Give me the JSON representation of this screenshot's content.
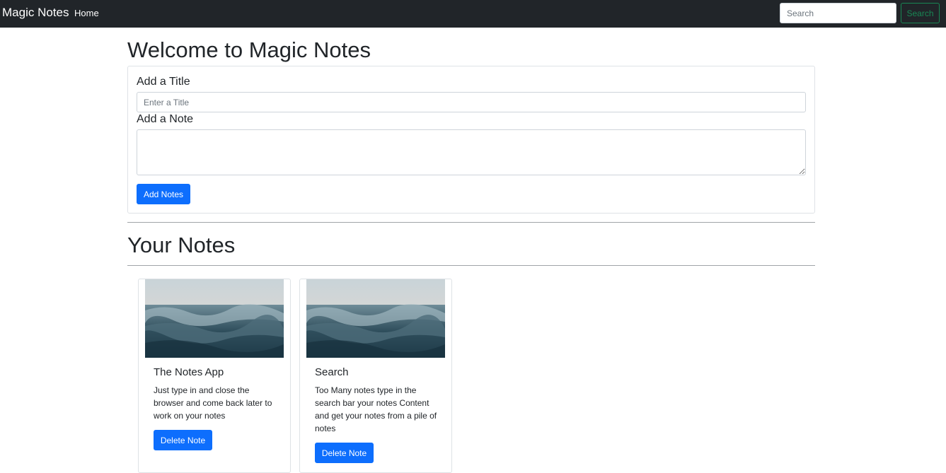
{
  "navbar": {
    "brand": "Magic Notes",
    "home_label": "Home",
    "search_placeholder": "Search",
    "search_button_label": "Search"
  },
  "main": {
    "welcome_heading": "Welcome to Magic Notes",
    "form": {
      "title_label": "Add a Title",
      "title_placeholder": "Enter a Title",
      "note_label": "Add a Note",
      "note_value": "",
      "add_button_label": "Add Notes"
    },
    "notes_heading": "Your Notes",
    "notes": [
      {
        "title": "The Notes App",
        "text": "Just type in and close the browser and come back later to work on your notes",
        "delete_label": "Delete Note"
      },
      {
        "title": "Search",
        "text": "Too Many notes type in the search bar your notes Content and get your notes from a pile of notes",
        "delete_label": "Delete Note"
      }
    ]
  },
  "colors": {
    "navbar_bg": "#212529",
    "primary": "#0d6efd",
    "success_outline": "#198754"
  }
}
